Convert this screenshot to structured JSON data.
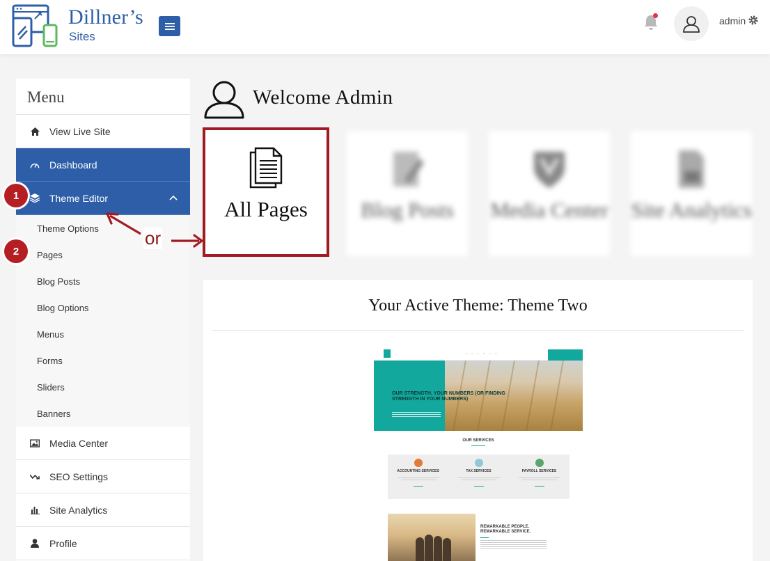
{
  "header": {
    "brand_name": "Dillner’s",
    "brand_sub": "Sites",
    "username": "admin"
  },
  "sidebar": {
    "title": "Menu",
    "items": [
      {
        "label": "View Live Site",
        "icon": "home-icon"
      },
      {
        "label": "Dashboard",
        "icon": "dashboard-icon",
        "active": true
      },
      {
        "label": "Theme Editor",
        "icon": "layers-icon",
        "active": true,
        "expanded": true
      },
      {
        "label": "Media Center",
        "icon": "image-icon"
      },
      {
        "label": "SEO Settings",
        "icon": "chart-line-icon"
      },
      {
        "label": "Site Analytics",
        "icon": "bar-chart-icon"
      },
      {
        "label": "Profile",
        "icon": "user-icon"
      }
    ],
    "submenu": [
      "Theme Options",
      "Pages",
      "Blog Posts",
      "Blog Options",
      "Menus",
      "Forms",
      "Sliders",
      "Banners"
    ]
  },
  "annotations": {
    "marker_1": "1",
    "marker_2": "2",
    "or_label": "or"
  },
  "main": {
    "welcome": "Welcome Admin",
    "cards": [
      {
        "label": "All Pages",
        "icon": "pages-icon",
        "highlighted": true
      },
      {
        "label": "Blog Posts",
        "icon": "edit-icon",
        "blurred": true
      },
      {
        "label": "Media Center",
        "icon": "shield-icon",
        "blurred": true
      },
      {
        "label": "Site Analytics",
        "icon": "document-chart-icon",
        "blurred": true
      }
    ],
    "theme_title": "Your Active Theme: Theme Two"
  },
  "preview": {
    "hero_heading": "OUR STRENGTH. YOUR NUMBERS (OR FINDING STRENGTH IN YOUR NUMBERS)",
    "services_title": "OUR SERVICES",
    "services": [
      "ACCOUNTING SERVICES",
      "TAX SERVICES",
      "PAYROLL SERVICES"
    ],
    "remarkable": "REMARKABLE PEOPLE. REMARKABLE SERVICE."
  },
  "colors": {
    "primary": "#2e5ea8",
    "annotation_red": "#a11c22",
    "preview_teal": "#13a89e"
  }
}
